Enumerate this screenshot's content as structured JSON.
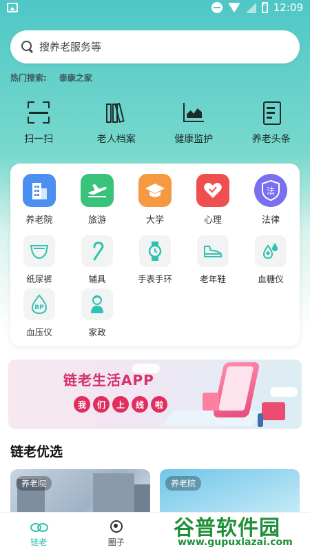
{
  "status_bar": {
    "time": "12:09"
  },
  "search": {
    "placeholder": "搜养老服务等"
  },
  "hot_search": {
    "label": "热门搜索:",
    "items": [
      "泰康之家"
    ]
  },
  "quick_actions": [
    {
      "label": "扫一扫",
      "icon": "scan-icon"
    },
    {
      "label": "老人档案",
      "icon": "archive-icon"
    },
    {
      "label": "健康监护",
      "icon": "health-monitor-icon"
    },
    {
      "label": "养老头条",
      "icon": "news-icon"
    }
  ],
  "services_primary": [
    {
      "label": "养老院",
      "icon": "building-icon",
      "color": "#4d8ff0"
    },
    {
      "label": "旅游",
      "icon": "airplane-icon",
      "color": "#39c27a"
    },
    {
      "label": "大学",
      "icon": "graduation-cap-icon",
      "color": "#f59a42"
    },
    {
      "label": "心理",
      "icon": "heart-icon",
      "color": "#ef4f4f"
    },
    {
      "label": "法律",
      "icon": "law-shield-icon",
      "color": "#7a6ff0",
      "glyph": "法"
    }
  ],
  "services_secondary": [
    {
      "label": "纸尿裤",
      "icon": "diaper-icon"
    },
    {
      "label": "辅具",
      "icon": "cane-icon"
    },
    {
      "label": "手表手环",
      "icon": "watch-icon"
    },
    {
      "label": "老年鞋",
      "icon": "shoe-icon"
    },
    {
      "label": "血糖仪",
      "icon": "glucose-meter-icon"
    },
    {
      "label": "血压仪",
      "icon": "blood-pressure-icon",
      "glyph": "BP"
    },
    {
      "label": "家政",
      "icon": "housekeeper-icon"
    }
  ],
  "banner": {
    "title": "链老生活APP",
    "subtitle_chars": [
      "我",
      "们",
      "上",
      "线",
      "啦"
    ]
  },
  "section": {
    "title": "链老优选"
  },
  "picks": [
    {
      "tag": "养老院"
    },
    {
      "tag": "养老院"
    }
  ],
  "tabbar": [
    {
      "label": "链老",
      "icon": "link-icon",
      "active": true
    },
    {
      "label": "圈子",
      "icon": "circle-icon",
      "active": false
    }
  ],
  "watermark": {
    "text": "谷普软件园",
    "url": "www.gupuxlazai.com"
  },
  "colors": {
    "accent": "#2fc1b1",
    "header_gradient_top": "#4fc7c6"
  }
}
